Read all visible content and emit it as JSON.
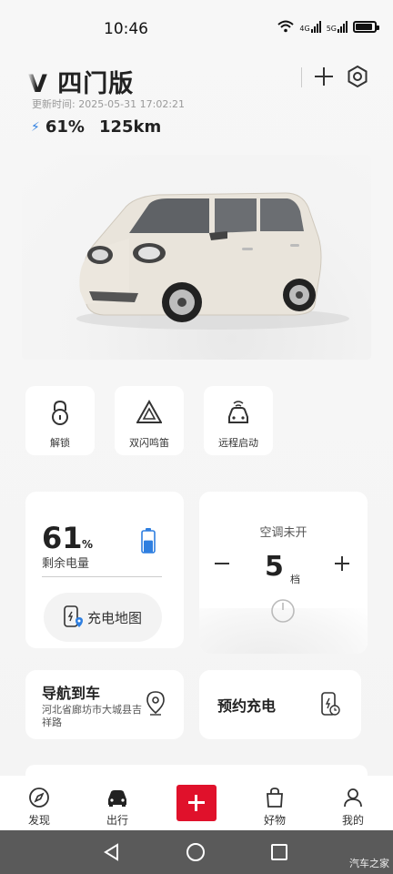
{
  "status_bar": {
    "time": "10:46",
    "network_1": "4G",
    "network_2": "5G"
  },
  "header": {
    "title": "V 四门版",
    "update_time": "更新时间:  2025-05-31 17:02:21",
    "battery_percent": "61%",
    "range": "125km"
  },
  "quick_actions": [
    {
      "label": "解锁",
      "icon": "unlock-icon"
    },
    {
      "label": "双闪鸣笛",
      "icon": "hazard-icon"
    },
    {
      "label": "远程启动",
      "icon": "remote-start-icon"
    }
  ],
  "battery_card": {
    "value": "61",
    "unit": "%",
    "label": "剩余电量",
    "level": 0.61,
    "charge_map_label": "充电地图"
  },
  "ac_card": {
    "status": "空调未开",
    "level": "5",
    "level_unit": "档"
  },
  "nav_card": {
    "title": "导航到车",
    "address": "河北省廊坊市大城县吉祥路"
  },
  "charge_card": {
    "title": "预约充电"
  },
  "tabbar": {
    "items": [
      {
        "label": "发现",
        "icon": "compass-icon"
      },
      {
        "label": "出行",
        "icon": "car-icon"
      },
      {
        "label": "好物",
        "icon": "shopping-bag-icon"
      },
      {
        "label": "我的",
        "icon": "profile-icon"
      }
    ]
  },
  "watermark": "汽车之家",
  "colors": {
    "accent_red": "#e0112b",
    "battery_blue": "#2f7fe0"
  }
}
